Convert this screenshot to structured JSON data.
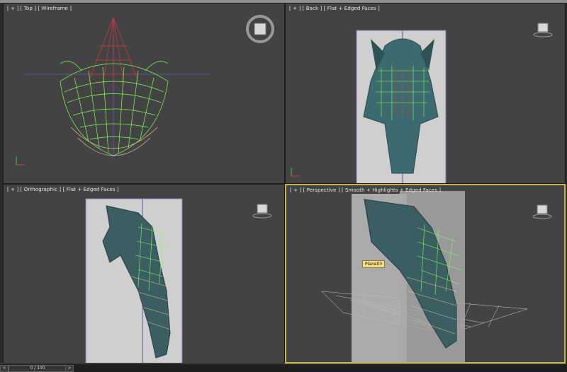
{
  "viewports": {
    "top": {
      "label": "[ + ] [ Top ] [ Wireframe ]"
    },
    "back": {
      "label": "[ + ] [ Back ] [ Flat + Edged Faces ]"
    },
    "ortho": {
      "label": "[ + ] [ Orthographic ] [ Flat + Edged Faces ]"
    },
    "persp": {
      "label": "[ + ] [ Perspective ] [ Smooth + Highlights + Edged Faces ]"
    }
  },
  "tooltip": {
    "object_name": "Plane03"
  },
  "timeline": {
    "frame_counter": "0 / 100",
    "prev_label": "<",
    "next_label": ">"
  },
  "colors": {
    "active_border": "#c9b44a",
    "viewport_bg": "#434343",
    "wire_green": "#7dff5a",
    "wire_red": "#d23a3a"
  },
  "icons": [
    "navcube-icon",
    "axis-tripod-icon",
    "viewcube-ring-icon"
  ]
}
